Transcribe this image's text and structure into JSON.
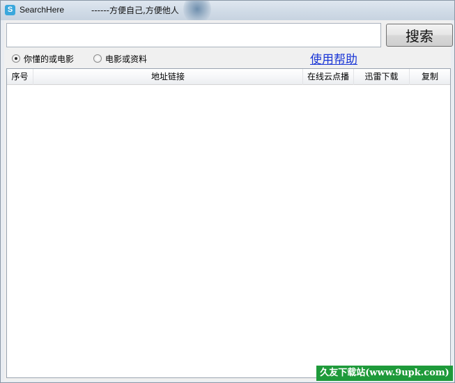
{
  "window": {
    "title": "SearchHere",
    "slogan": "------方便自己,方便他人",
    "icon": "app-logo-icon"
  },
  "search": {
    "value": "",
    "button_label": "搜索"
  },
  "mode": {
    "options": [
      {
        "label": "你懂的或电影",
        "selected": true
      },
      {
        "label": "电影或资料",
        "selected": false
      }
    ]
  },
  "help_link": "使用帮助",
  "table": {
    "columns": [
      "序号",
      "地址链接",
      "在线云点播",
      "迅雷下载",
      "复制"
    ],
    "rows": []
  },
  "watermark": "久友下载站(www.9upk.com)"
}
